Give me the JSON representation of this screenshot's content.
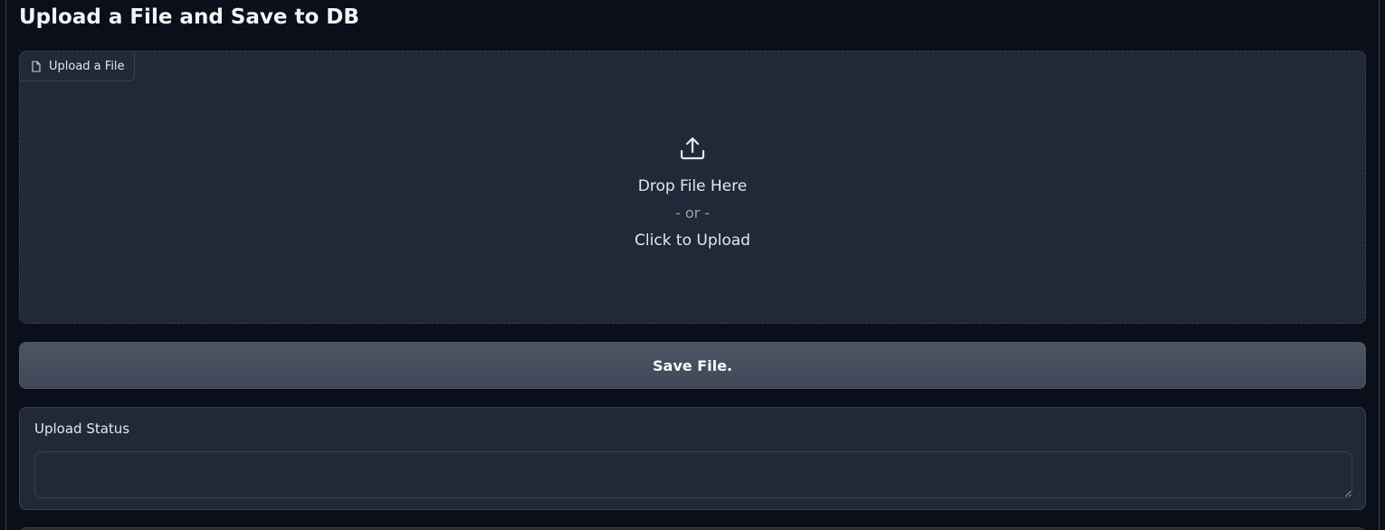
{
  "page": {
    "title": "Upload a File and Save to DB"
  },
  "upload": {
    "label": "Upload a File",
    "label_icon": "file-icon",
    "upload_icon": "upload-icon",
    "drop_text": "Drop File Here",
    "or_text": "- or -",
    "click_text": "Click to Upload"
  },
  "actions": {
    "save_label": "Save File."
  },
  "status": {
    "label": "Upload Status",
    "value": ""
  },
  "colors": {
    "background": "#0b0f19",
    "panel": "#1f2937",
    "border": "#374151",
    "button": "#4b5563",
    "text": "#e5e7eb",
    "muted": "#9ca3af"
  }
}
